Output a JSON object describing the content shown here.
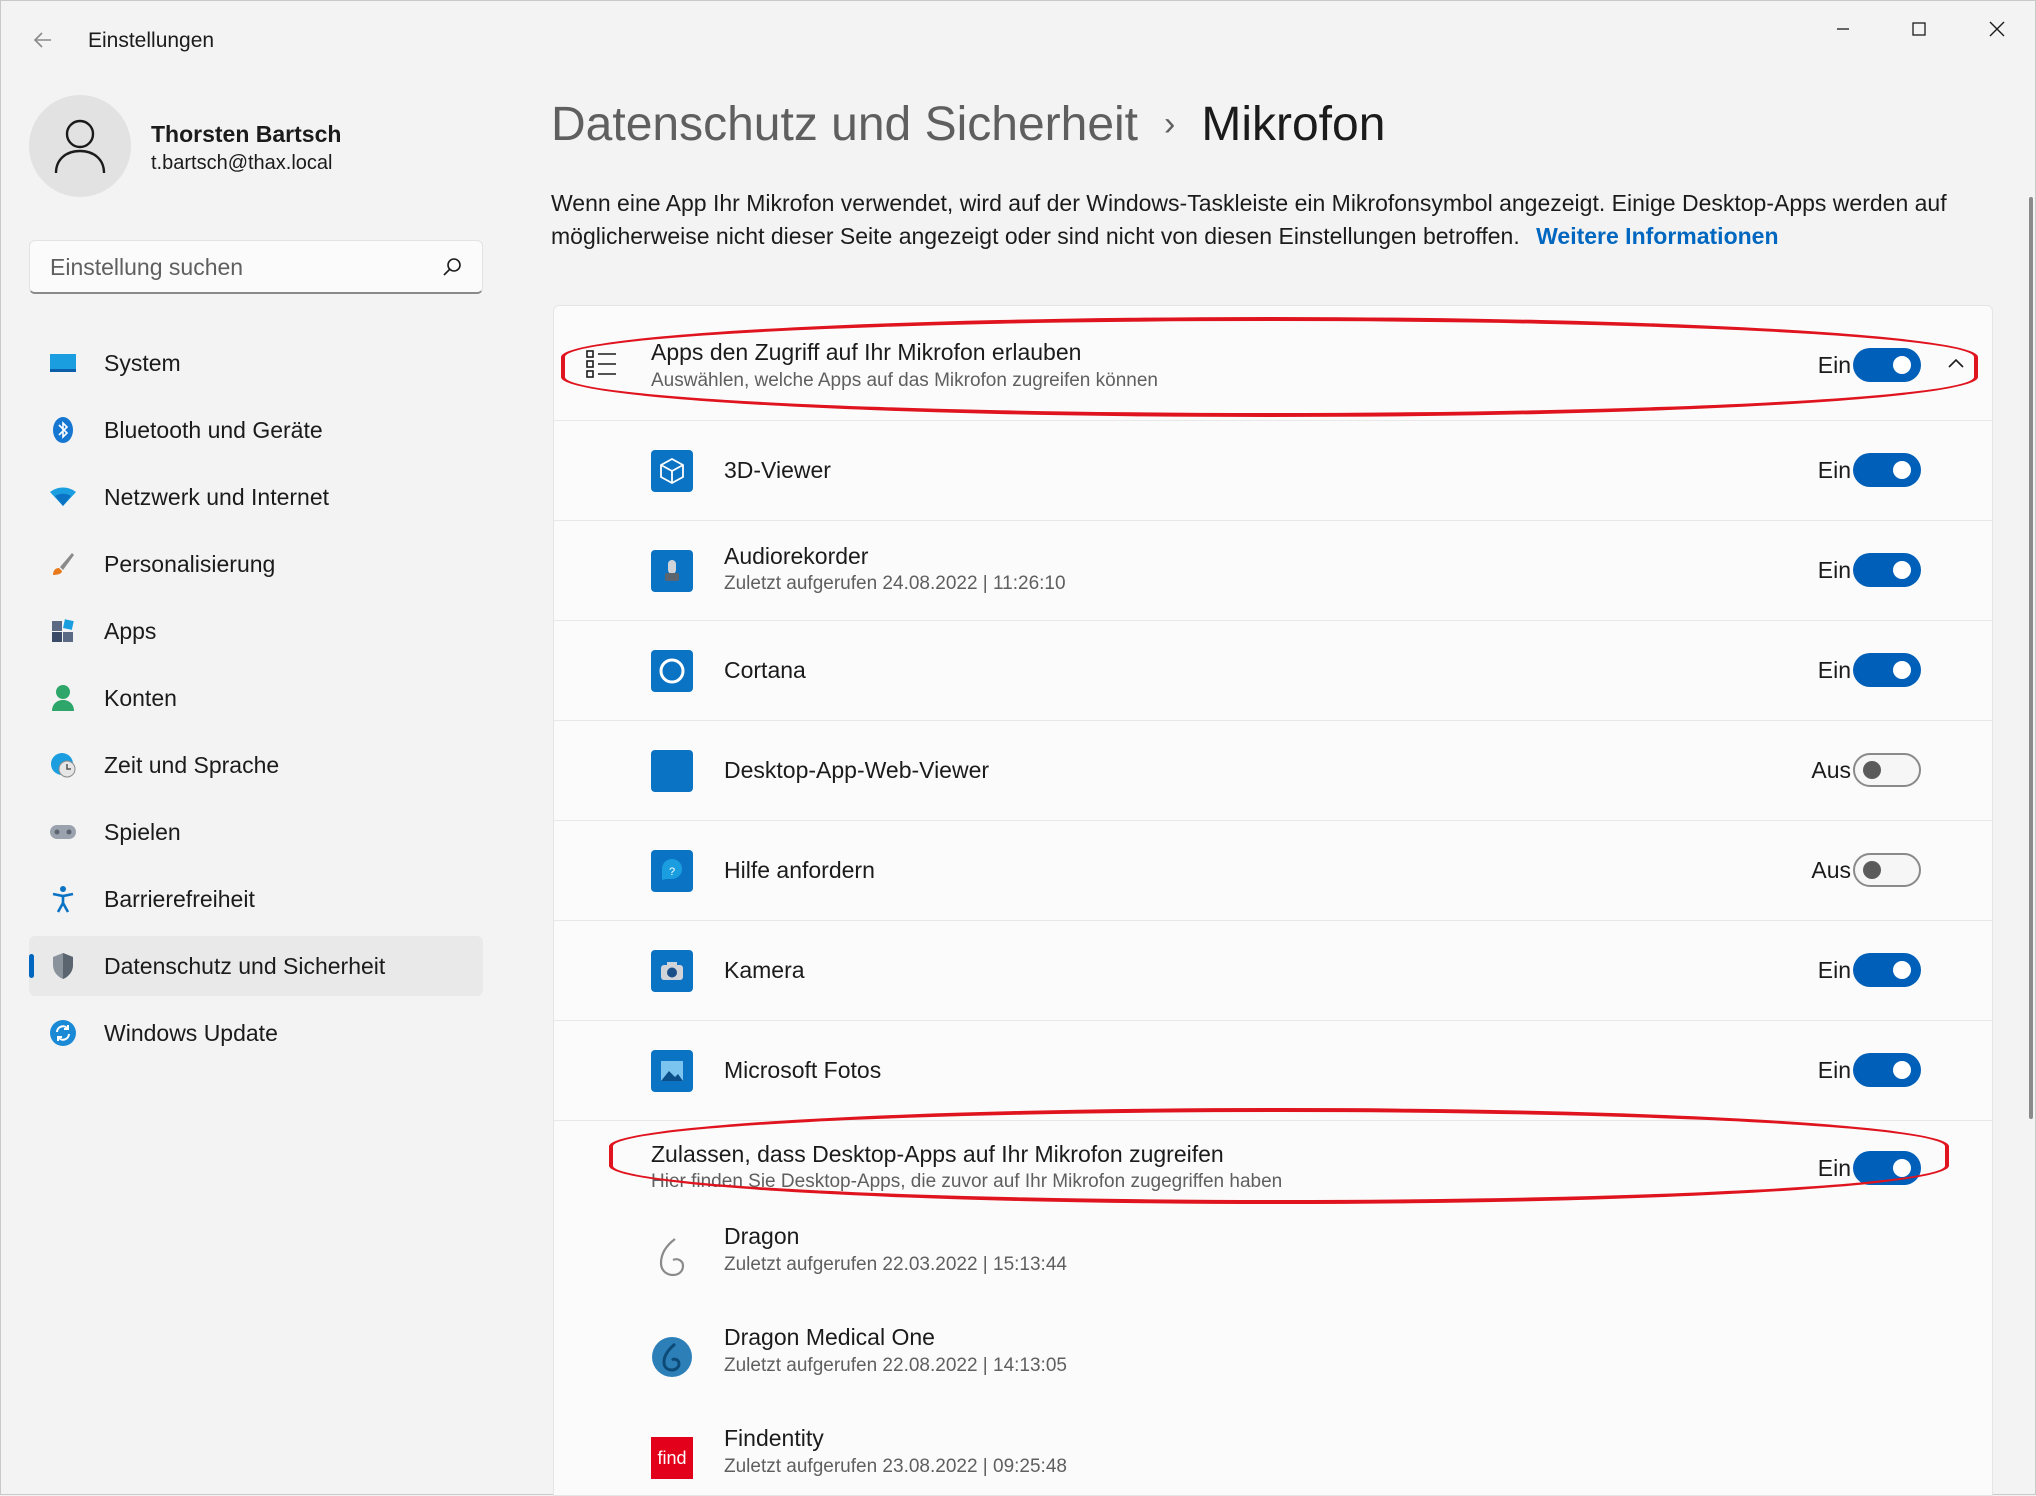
{
  "window": {
    "title": "Einstellungen"
  },
  "profile": {
    "name": "Thorsten Bartsch",
    "email": "t.bartsch@thax.local"
  },
  "search": {
    "placeholder": "Einstellung suchen"
  },
  "sidebar": {
    "items": [
      {
        "label": "System",
        "icon": "system-icon"
      },
      {
        "label": "Bluetooth und Geräte",
        "icon": "bluetooth-icon"
      },
      {
        "label": "Netzwerk und Internet",
        "icon": "wifi-icon"
      },
      {
        "label": "Personalisierung",
        "icon": "brush-icon"
      },
      {
        "label": "Apps",
        "icon": "apps-icon"
      },
      {
        "label": "Konten",
        "icon": "person-icon"
      },
      {
        "label": "Zeit und Sprache",
        "icon": "clock-globe-icon"
      },
      {
        "label": "Spielen",
        "icon": "gamepad-icon"
      },
      {
        "label": "Barrierefreiheit",
        "icon": "accessibility-icon"
      },
      {
        "label": "Datenschutz und Sicherheit",
        "icon": "shield-icon",
        "active": true
      },
      {
        "label": "Windows Update",
        "icon": "update-icon"
      }
    ]
  },
  "header": {
    "parent": "Datenschutz und Sicherheit",
    "separator": "›",
    "current": "Mikrofon"
  },
  "description": {
    "text": "Wenn eine App Ihr Mikrofon verwendet, wird auf der Windows-Taskleiste ein Mikrofonsymbol angezeigt. Einige Desktop-Apps werden auf möglicherweise nicht dieser Seite angezeigt oder sind nicht von diesen Einstellungen betroffen.",
    "link": "Weitere Informationen"
  },
  "main_setting": {
    "title": "Apps den Zugriff auf Ihr Mikrofon erlauben",
    "subtitle": "Auswählen, welche Apps auf das Mikrofon zugreifen können",
    "state": "Ein",
    "on": true
  },
  "apps": [
    {
      "name": "3D-Viewer",
      "last": "",
      "state": "Ein",
      "on": true,
      "icon": "cube-icon"
    },
    {
      "name": "Audiorekorder",
      "last": "Zuletzt aufgerufen 24.08.2022  |  11:26:10",
      "state": "Ein",
      "on": true,
      "icon": "microphone-icon"
    },
    {
      "name": "Cortana",
      "last": "",
      "state": "Ein",
      "on": true,
      "icon": "cortana-icon"
    },
    {
      "name": "Desktop-App-Web-Viewer",
      "last": "",
      "state": "Aus",
      "on": false,
      "icon": "webview-icon"
    },
    {
      "name": "Hilfe anfordern",
      "last": "",
      "state": "Aus",
      "on": false,
      "icon": "help-icon"
    },
    {
      "name": "Kamera",
      "last": "",
      "state": "Ein",
      "on": true,
      "icon": "camera-icon"
    },
    {
      "name": "Microsoft Fotos",
      "last": "",
      "state": "Ein",
      "on": true,
      "icon": "photos-icon"
    }
  ],
  "desktop_setting": {
    "title": "Zulassen, dass Desktop-Apps auf Ihr Mikrofon zugreifen",
    "subtitle": "Hier finden Sie Desktop-Apps, die zuvor auf Ihr Mikrofon zugegriffen haben",
    "state": "Ein",
    "on": true
  },
  "desktop_apps": [
    {
      "name": "Dragon",
      "last": "Zuletzt aufgerufen 22.03.2022  |  15:13:44",
      "icon": "dragon-icon"
    },
    {
      "name": "Dragon Medical One",
      "last": "Zuletzt aufgerufen 22.08.2022  |  14:13:05",
      "icon": "dragon-medical-icon"
    },
    {
      "name": "Findentity",
      "last": "Zuletzt aufgerufen 23.08.2022  |  09:25:48",
      "icon": "findentity-icon",
      "icon_text": "find"
    }
  ],
  "colors": {
    "accent": "#005fb8",
    "highlight": "#e0141e",
    "link": "#0067c0"
  }
}
